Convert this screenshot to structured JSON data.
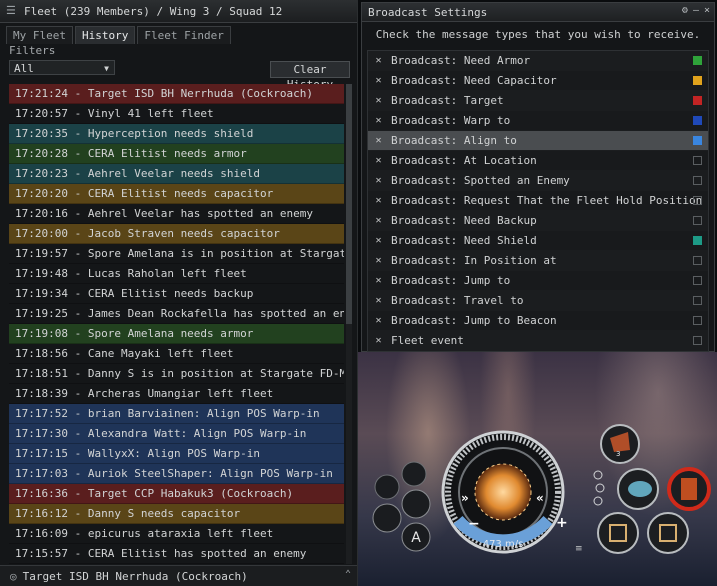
{
  "fleet_window": {
    "title": "Fleet (239 Members) / Wing 3 / Squad 12",
    "tabs": [
      "My Fleet",
      "History",
      "Fleet Finder"
    ],
    "active_tab": "History",
    "filters_label": "Filters",
    "filter_value": "All",
    "clear_button": "Clear History",
    "history": [
      {
        "text": "17:21:24 - Target ISD BH Nerrhuda (Cockroach)",
        "color": "red"
      },
      {
        "text": "17:20:57 - Vinyl 41 left fleet",
        "color": "none"
      },
      {
        "text": "17:20:35 - Hyperception needs shield",
        "color": "teal"
      },
      {
        "text": "17:20:28 - CERA Elitist needs armor",
        "color": "green"
      },
      {
        "text": "17:20:23 - Aehrel Veelar needs shield",
        "color": "teal"
      },
      {
        "text": "17:20:20 - CERA Elitist needs capacitor",
        "color": "amber"
      },
      {
        "text": "17:20:16 - Aehrel Veelar has spotted an enemy",
        "color": "none"
      },
      {
        "text": "17:20:00 - Jacob Straven needs capacitor",
        "color": "amber"
      },
      {
        "text": "17:19:57 - Spore Amelana is in position at Stargate FD-MLJ",
        "color": "none"
      },
      {
        "text": "17:19:48 - Lucas Raholan left fleet",
        "color": "none"
      },
      {
        "text": "17:19:34 - CERA Elitist needs backup",
        "color": "none"
      },
      {
        "text": "17:19:25 - James Dean Rockafella has spotted an enemy",
        "color": "none"
      },
      {
        "text": "17:19:08 - Spore Amelana needs armor",
        "color": "green"
      },
      {
        "text": "17:18:56 - Cane Mayaki left fleet",
        "color": "none"
      },
      {
        "text": "17:18:51 - Danny S is in position at Stargate FD-MLJ",
        "color": "none"
      },
      {
        "text": "17:18:39 - Archeras Umangiar left fleet",
        "color": "none"
      },
      {
        "text": "17:17:52 - brian Barviainen: Align POS Warp-in",
        "color": "blue"
      },
      {
        "text": "17:17:30 - Alexandra Watt: Align POS Warp-in",
        "color": "blue"
      },
      {
        "text": "17:17:15 - WallyxX: Align POS Warp-in",
        "color": "blue"
      },
      {
        "text": "17:17:03 - Auriok SteelShaper: Align POS Warp-in",
        "color": "blue"
      },
      {
        "text": "17:16:36 - Target CCP Habakuk3 (Cockroach)",
        "color": "red"
      },
      {
        "text": "17:16:12 - Danny S needs capacitor",
        "color": "amber"
      },
      {
        "text": "17:16:09 - epicurus ataraxia left fleet",
        "color": "none"
      },
      {
        "text": "17:15:57 - CERA Elitist has spotted an enemy",
        "color": "none"
      }
    ],
    "footer_text": "Target ISD BH Nerrhuda (Cockroach)"
  },
  "broadcast_window": {
    "title": "Broadcast Settings",
    "instruction": "Check the message types that you wish to receive.",
    "items": [
      {
        "label": "Broadcast: Need Armor",
        "swatch": "#2fa33a",
        "selected": false
      },
      {
        "label": "Broadcast: Need Capacitor",
        "swatch": "#e0a21c",
        "selected": false
      },
      {
        "label": "Broadcast: Target",
        "swatch": "#c22424",
        "selected": false
      },
      {
        "label": "Broadcast: Warp to",
        "swatch": "#1f49b8",
        "selected": false
      },
      {
        "label": "Broadcast: Align to",
        "swatch": "#3a86e0",
        "selected": true
      },
      {
        "label": "Broadcast: At Location",
        "swatch": "",
        "selected": false
      },
      {
        "label": "Broadcast: Spotted an Enemy",
        "swatch": "",
        "selected": false
      },
      {
        "label": "Broadcast: Request That the Fleet Hold Position",
        "swatch": "",
        "selected": false
      },
      {
        "label": "Broadcast: Need Backup",
        "swatch": "",
        "selected": false
      },
      {
        "label": "Broadcast: Need Shield",
        "swatch": "#1d9a86",
        "selected": false
      },
      {
        "label": "Broadcast: In Position at",
        "swatch": "",
        "selected": false
      },
      {
        "label": "Broadcast: Jump to",
        "swatch": "",
        "selected": false
      },
      {
        "label": "Broadcast: Travel to",
        "swatch": "",
        "selected": false
      },
      {
        "label": "Broadcast: Jump to Beacon",
        "swatch": "",
        "selected": false
      },
      {
        "label": "Fleet event",
        "swatch": "",
        "selected": false
      }
    ]
  },
  "hud": {
    "speed": "473 m/s",
    "module_count": "3"
  }
}
